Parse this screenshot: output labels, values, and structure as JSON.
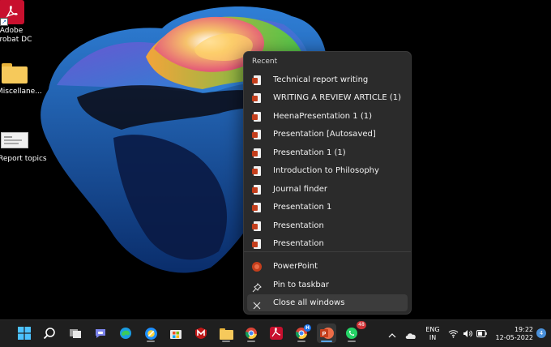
{
  "desktop": {
    "icons": [
      {
        "label_line1": "Adobe",
        "label_line2": "Acrobat DC"
      },
      {
        "label": "Miscellane..."
      },
      {
        "label": "Report topics"
      }
    ]
  },
  "jumplist": {
    "heading": "Recent",
    "recent": [
      "Technical report writing",
      "WRITING A REVIEW ARTICLE (1)",
      "HeenaPresentation 1 (1)",
      "Presentation [Autosaved]",
      "Presentation 1 (1)",
      "Introduction to Philosophy",
      "Journal finder",
      "Presentation 1",
      "Presentation",
      "Presentation"
    ],
    "app_label": "PowerPoint",
    "pin_label": "Pin to taskbar",
    "close_label": "Close all windows"
  },
  "taskbar": {
    "whatsapp_badge": "48",
    "chrome_profile_initial": "H",
    "language": "ENG",
    "region": "IN",
    "time": "19:22",
    "date": "12-05-2022",
    "notification_count": "4"
  },
  "colors": {
    "menu_bg": "#2b2b2b",
    "taskbar_bg": "#1f1f1f",
    "powerpoint": "#c43e1c",
    "accent": "#5aa7e8"
  }
}
